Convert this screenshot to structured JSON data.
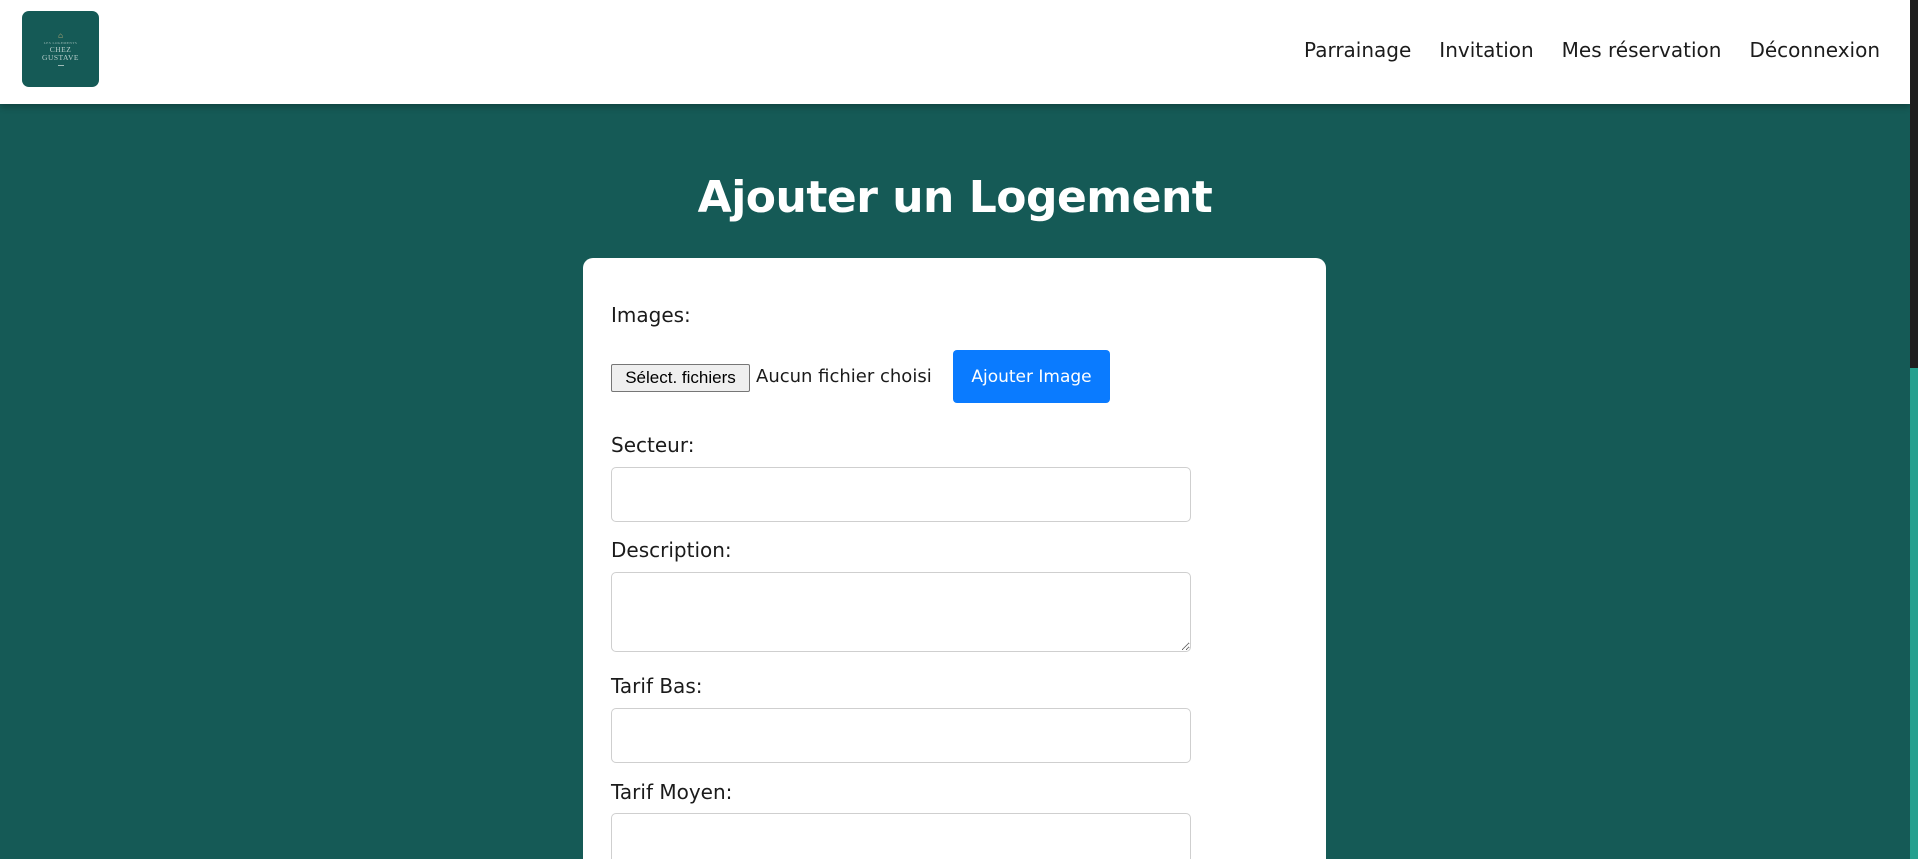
{
  "header": {
    "logo": {
      "icon": "house-icon",
      "top_text": "LES LOGEMENTS",
      "brand_line1": "CHEZ",
      "brand_line2": "GUSTAVE"
    },
    "nav": [
      {
        "label": "Parrainage"
      },
      {
        "label": "Invitation"
      },
      {
        "label": "Mes réservation"
      },
      {
        "label": "Déconnexion"
      }
    ]
  },
  "page": {
    "title": "Ajouter un Logement"
  },
  "form": {
    "images_label": "Images:",
    "file_button_label": "Sélect. fichiers",
    "file_status": "Aucun fichier choisi",
    "add_image_button": "Ajouter Image",
    "secteur_label": "Secteur:",
    "secteur_value": "",
    "description_label": "Description:",
    "description_value": "",
    "tarif_bas_label": "Tarif Bas:",
    "tarif_bas_value": "",
    "tarif_moyen_label": "Tarif Moyen:",
    "tarif_moyen_value": ""
  },
  "colors": {
    "background": "#155a56",
    "header": "#ffffff",
    "primary_button": "#0a7bff",
    "scrollbar_accent": "#25a08e"
  }
}
